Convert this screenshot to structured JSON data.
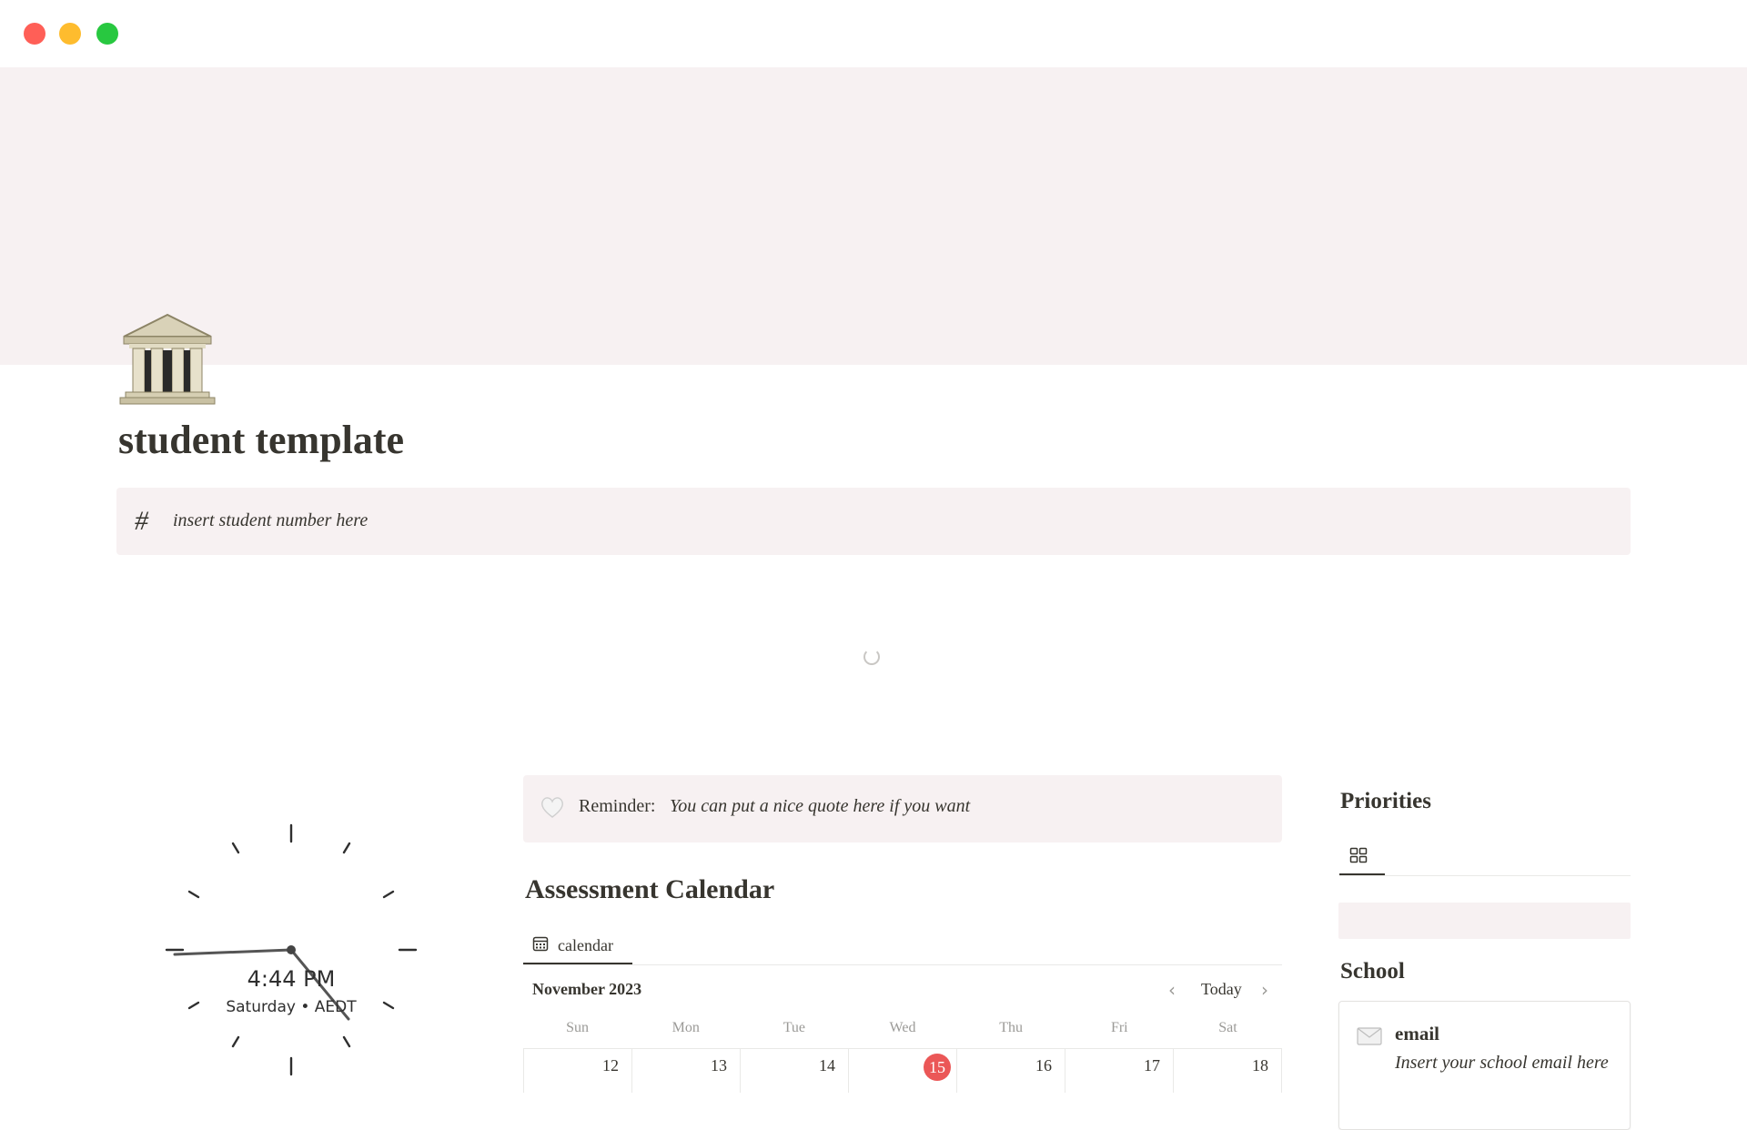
{
  "page": {
    "title": "student template",
    "icon": "classical-building-icon",
    "property": {
      "icon": "hash-icon",
      "value": "insert student number here"
    }
  },
  "clock": {
    "time": "4:44 PM",
    "day": "Saturday • AEDT"
  },
  "reminder": {
    "icon": "white-heart-icon",
    "label": "Reminder:",
    "quote": "You can put a nice quote here if you want"
  },
  "assessment_calendar": {
    "title": "Assessment Calendar",
    "view_tab": "calendar",
    "month": "November 2023",
    "today_label": "Today",
    "prev_icon": "chevron-left-icon",
    "next_icon": "chevron-right-icon",
    "weekdays": [
      "Sun",
      "Mon",
      "Tue",
      "Wed",
      "Thu",
      "Fri",
      "Sat"
    ],
    "week": [
      "12",
      "13",
      "14",
      "15",
      "16",
      "17",
      "18"
    ],
    "today": "15",
    "today_color": "#eb5757"
  },
  "priorities": {
    "title": "Priorities",
    "view_icon": "gallery-grid-icon"
  },
  "school": {
    "title": "School",
    "email_label": "email",
    "email_value": "Insert your school email here",
    "email_icon": "envelope-icon"
  },
  "colors": {
    "cover": "#f7f1f2",
    "callout": "#f7f1f2",
    "text": "#37352f"
  }
}
